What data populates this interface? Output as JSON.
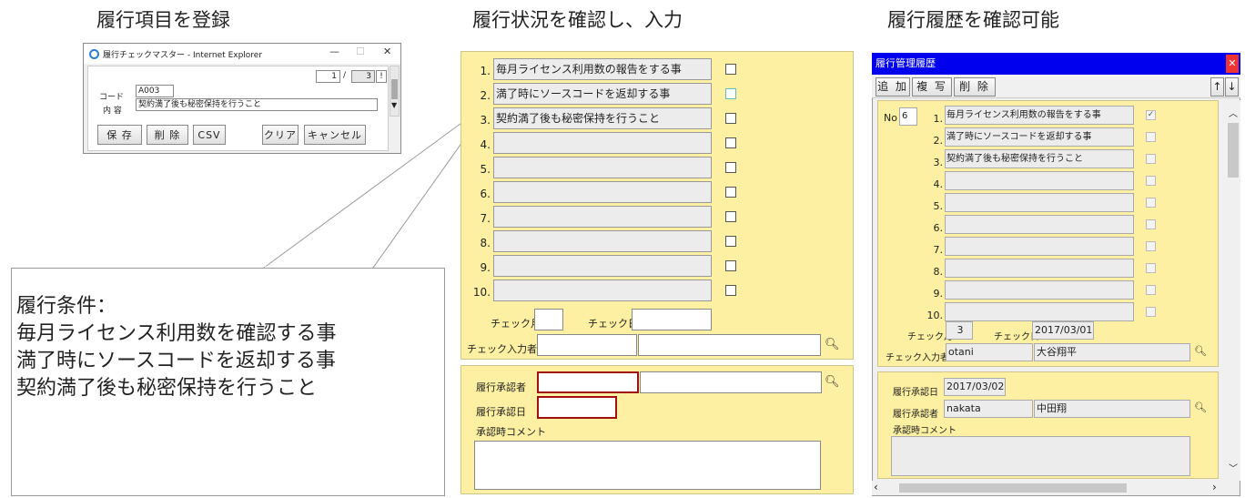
{
  "captions": {
    "register": "履行項目を登録",
    "status": "履行状況を確認し、入力",
    "history": "履行履歴を確認可能"
  },
  "ie_window": {
    "title": "履行チェックマスター - Internet Explorer",
    "minimize": "—",
    "maximize": "☐",
    "close": "✕",
    "page_current": "1",
    "page_sep": "/",
    "page_total": "3",
    "page_btn": "!",
    "code_label": "コード",
    "code_value": "A003",
    "content_label": "内 容",
    "content_value": "契約満了後も秘密保持を行うこと",
    "buttons": {
      "save": "保 存",
      "delete": "削 除",
      "csv": "CSV",
      "clear": "クリア",
      "cancel": "キャンセル"
    }
  },
  "callout": {
    "text": "履行条件：\n毎月ライセンス利用数を確認する事\n満了時にソースコードを返却する事\n契約満了後も秘密保持を行うこと"
  },
  "status_panel": {
    "rows": [
      {
        "num": "1.",
        "text": "毎月ライセンス利用数の報告をする事"
      },
      {
        "num": "2.",
        "text": "満了時にソースコードを返却する事"
      },
      {
        "num": "3.",
        "text": "契約満了後も秘密保持を行うこと"
      },
      {
        "num": "4.",
        "text": ""
      },
      {
        "num": "5.",
        "text": ""
      },
      {
        "num": "6.",
        "text": ""
      },
      {
        "num": "7.",
        "text": ""
      },
      {
        "num": "8.",
        "text": ""
      },
      {
        "num": "9.",
        "text": ""
      },
      {
        "num": "10.",
        "text": ""
      }
    ],
    "check_month_label": "チェック月",
    "check_day_label": "チェック日",
    "checker_label": "チェック入力者",
    "approver_label": "履行承認者",
    "approve_date_label": "履行承認日",
    "comment_label": "承認時コメント"
  },
  "history_window": {
    "title": "履行管理履歴",
    "close": "✕",
    "toolbar": {
      "add": "追 加",
      "copy": "複 写",
      "delete": "削 除",
      "up": "↑",
      "down": "↓"
    },
    "no_label": "No",
    "no_value": "6",
    "rows": [
      {
        "num": "1.",
        "text": "毎月ライセンス利用数の報告をする事",
        "checked": true
      },
      {
        "num": "2.",
        "text": "満了時にソースコードを返却する事",
        "checked": false
      },
      {
        "num": "3.",
        "text": "契約満了後も秘密保持を行うこと",
        "checked": false
      },
      {
        "num": "4.",
        "text": "",
        "checked": false
      },
      {
        "num": "5.",
        "text": "",
        "checked": false
      },
      {
        "num": "6.",
        "text": "",
        "checked": false
      },
      {
        "num": "7.",
        "text": "",
        "checked": false
      },
      {
        "num": "8.",
        "text": "",
        "checked": false
      },
      {
        "num": "9.",
        "text": "",
        "checked": false
      },
      {
        "num": "10.",
        "text": "",
        "checked": false
      }
    ],
    "check_month_label": "チェック月",
    "check_month_value": "3",
    "check_day_label": "チェック日",
    "check_day_value": "2017/03/01",
    "checker_label": "チェック入力者",
    "checker_id": "otani",
    "checker_name": "大谷翔平",
    "approve_date_label": "履行承認日",
    "approve_date_value": "2017/03/02",
    "approver_label": "履行承認者",
    "approver_id": "nakata",
    "approver_name": "中田翔",
    "comment_label": "承認時コメント"
  },
  "colors": {
    "panel_yellow": "#fdf0a2",
    "title_blue": "#0000ee",
    "required_red": "#a01010"
  }
}
